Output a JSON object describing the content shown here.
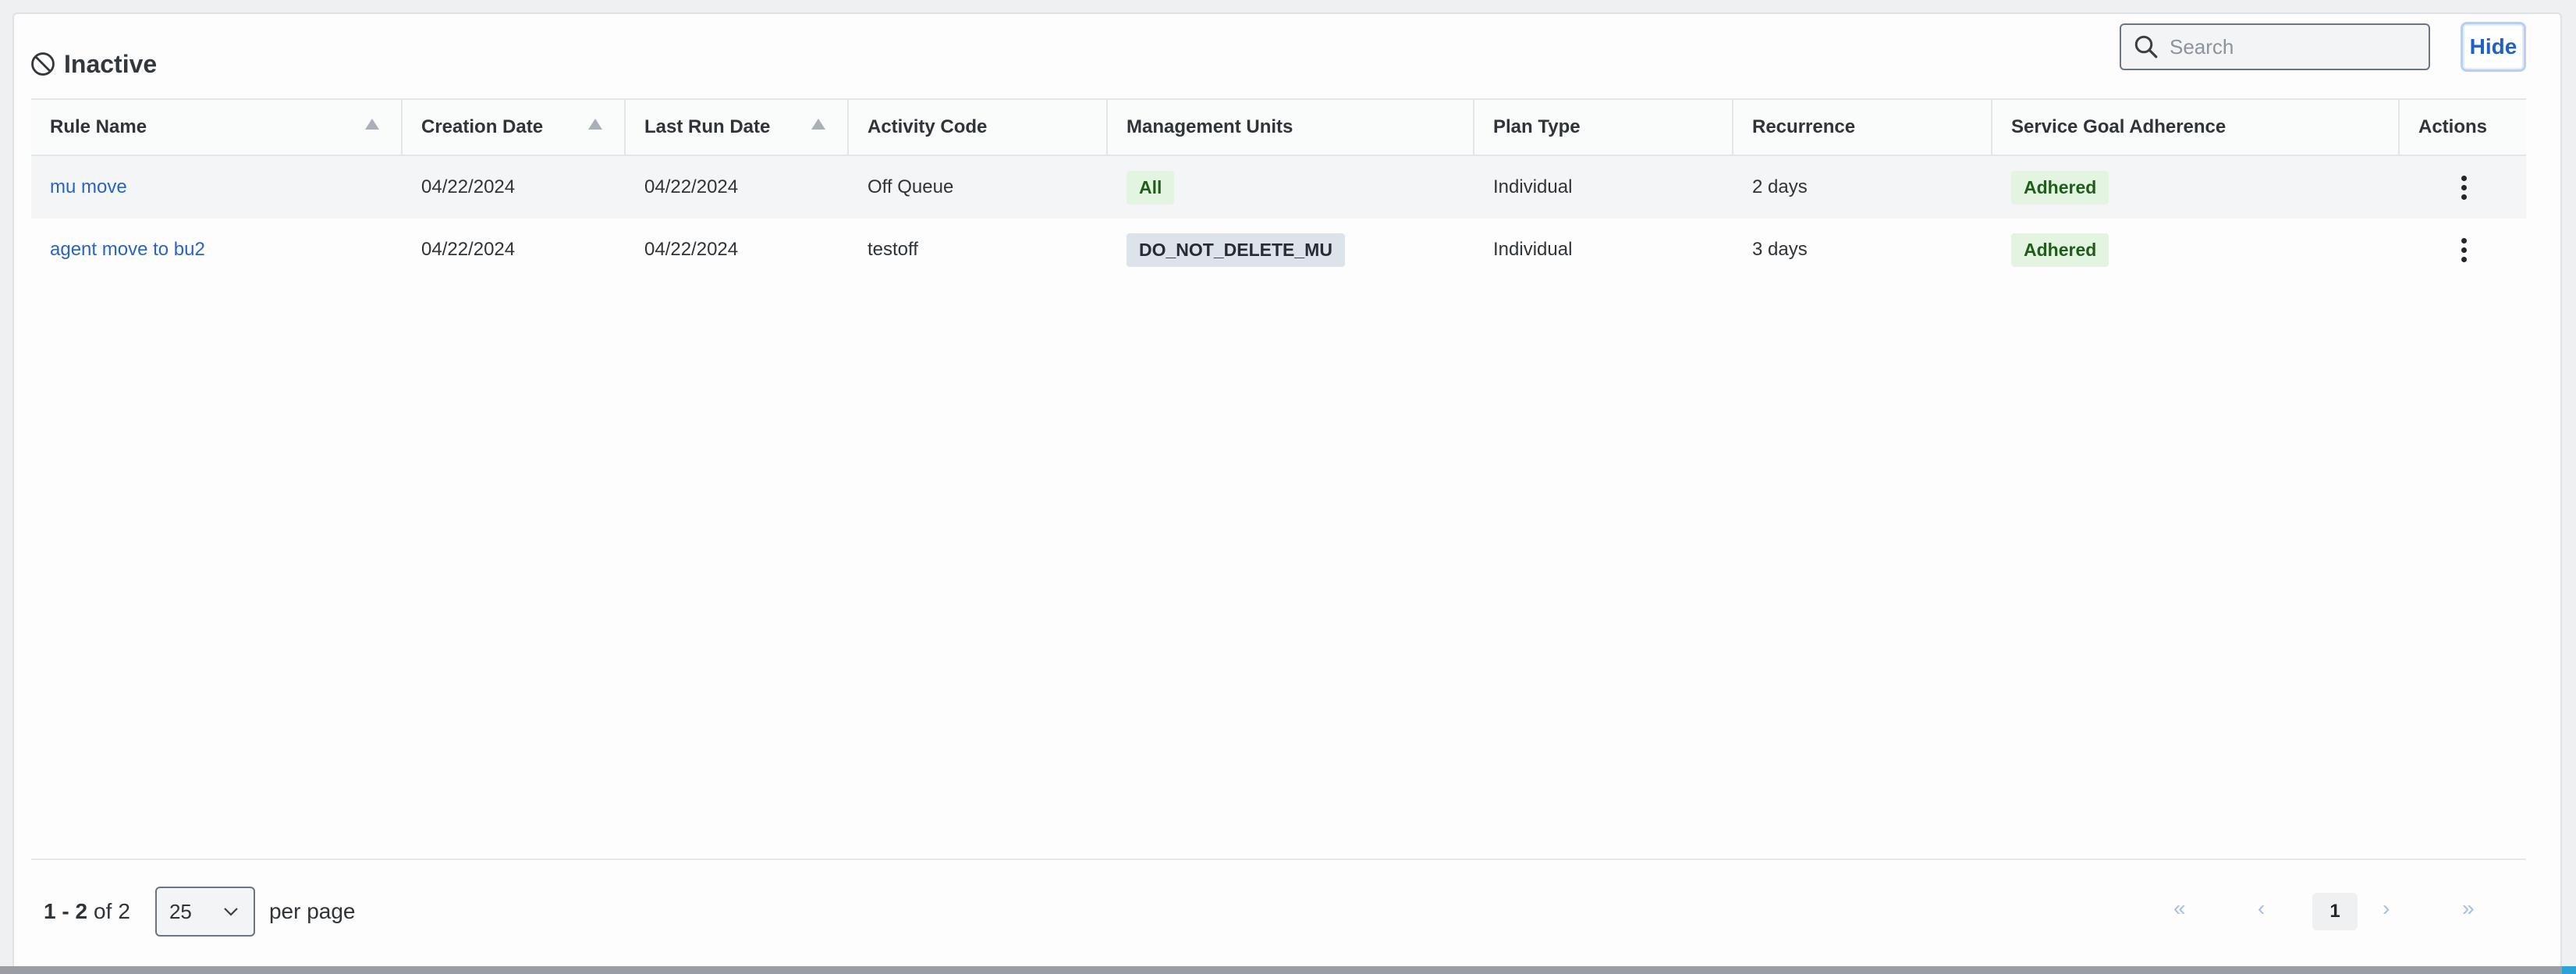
{
  "header": {
    "title": "Inactive",
    "icon": "block-icon"
  },
  "search": {
    "placeholder": "Search",
    "value": ""
  },
  "hide_button": {
    "label": "Hide"
  },
  "table": {
    "columns": [
      "Rule Name",
      "Creation Date",
      "Last Run Date",
      "Activity Code",
      "Management Units",
      "Plan Type",
      "Recurrence",
      "Service Goal Adherence",
      "Actions"
    ],
    "rows": [
      {
        "rule_name": "mu move",
        "creation_date": "04/22/2024",
        "last_run_date": "04/22/2024",
        "activity_code": "Off Queue",
        "management_units": "All",
        "plan_type": "Individual",
        "recurrence": "2 days",
        "adherence": "Adhered"
      },
      {
        "rule_name": "agent move to bu2",
        "creation_date": "04/22/2024",
        "last_run_date": "04/22/2024",
        "activity_code": "testoff",
        "management_units": "DO_NOT_DELETE_MU",
        "plan_type": "Individual",
        "recurrence": "3 days",
        "adherence": "Adhered"
      }
    ]
  },
  "footer": {
    "range": "1 - 2",
    "of_label": "of",
    "total": "2",
    "per_page_value": "25",
    "per_page_label": "per page",
    "current_page": "1"
  },
  "colors": {
    "link": "#2a63c6",
    "accent": "#2160c4",
    "adhered_bg": "#e3f4e0",
    "adhered_text": "#1f5e1a"
  }
}
